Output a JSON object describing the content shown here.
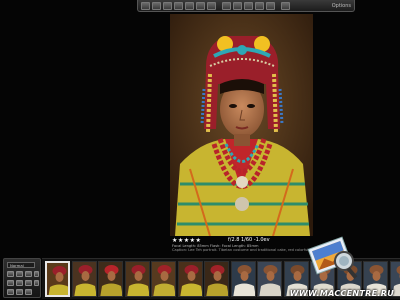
{
  "toolbar": {
    "label": "Options"
  },
  "photo": {
    "subject": "portrait of a girl in traditional headdress"
  },
  "caption": {
    "rating": "★★★★★",
    "exif": "f/2.8  1/60  -1.0ev",
    "meta_line1": "Focal Length: 85mm  Flash: Focal Length: 85mm",
    "meta_line2": "Caption: Lee Teh portrait. Tibetan costume and traditional cake, red colorful hats"
  },
  "controls": {
    "select_value": "Normal"
  },
  "filmstrip": {
    "thumb_count": 14,
    "selected_index": 0
  },
  "watermark": {
    "url": "WWW.MACCENTRE.RU"
  },
  "colors": {
    "background": "#050505",
    "accent": "#e8e8e8"
  }
}
